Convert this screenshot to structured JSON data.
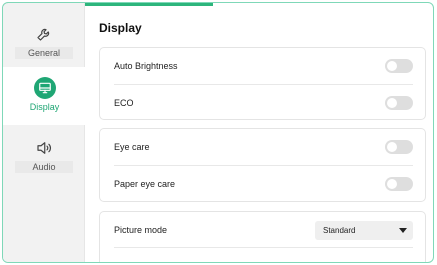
{
  "sidebar": {
    "items": [
      {
        "label": "General",
        "icon": "wrench-icon",
        "active": false
      },
      {
        "label": "Display",
        "icon": "monitor-icon",
        "active": true
      },
      {
        "label": "Audio",
        "icon": "speaker-icon",
        "active": false
      }
    ]
  },
  "main": {
    "title": "Display",
    "group1": [
      {
        "label": "Auto Brightness",
        "enabled": false
      },
      {
        "label": "ECO",
        "enabled": false
      }
    ],
    "group2": [
      {
        "label": "Eye care",
        "enabled": false
      },
      {
        "label": "Paper eye care",
        "enabled": false
      }
    ],
    "group3": {
      "picture_mode_label": "Picture mode",
      "picture_mode_value": "Standard"
    }
  },
  "colors": {
    "accent": "#1fa674",
    "border_accent": "#7fd8b8",
    "toggle_off": "#dedede"
  }
}
